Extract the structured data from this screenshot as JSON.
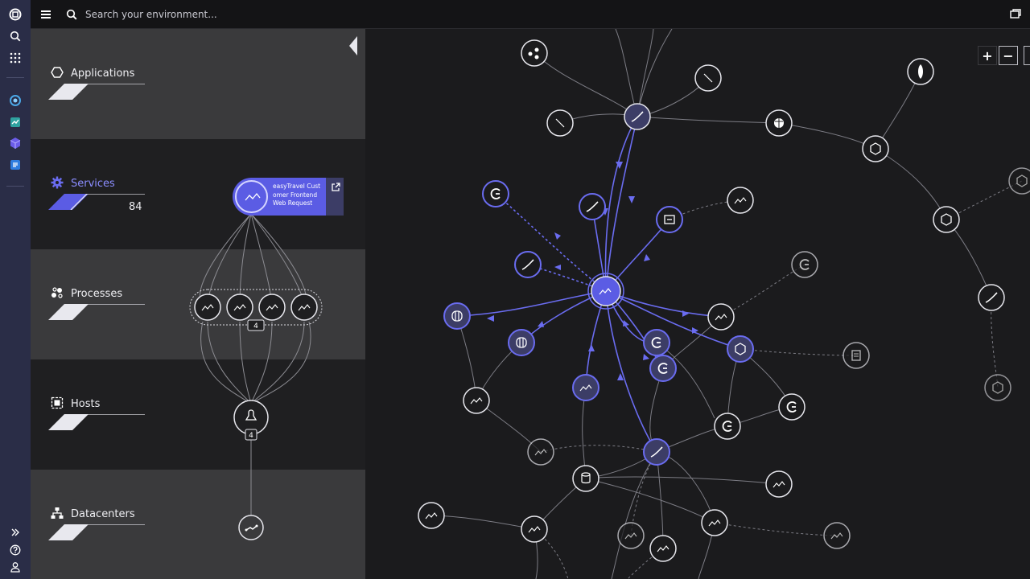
{
  "search": {
    "placeholder": "Search your environment..."
  },
  "layers": [
    {
      "key": "applications",
      "label": "Applications",
      "count": ""
    },
    {
      "key": "services",
      "label": "Services",
      "count": "84"
    },
    {
      "key": "processes",
      "label": "Processes",
      "count": ""
    },
    {
      "key": "hosts",
      "label": "Hosts",
      "count": ""
    },
    {
      "key": "datacenters",
      "label": "Datacenters",
      "count": ""
    }
  ],
  "selected_service": {
    "name": "easyTravel Customer Frontend Web Request"
  },
  "process_group": {
    "badge": "4"
  },
  "host_group": {
    "badge": "4"
  },
  "colors": {
    "accent": "#5b5ce4",
    "rail": "#2a2d47",
    "node_border": "#e6e6ec",
    "edge": "#8a8a92"
  },
  "zoom": {
    "in": "+",
    "out": "−"
  },
  "icons": [
    "dynatrace-logo-icon",
    "search-icon",
    "apps-grid-icon",
    "hexagon-icon",
    "gear-icon",
    "processes-icon",
    "hosts-icon",
    "datacenter-icon",
    "windows-icon",
    "menu-icon",
    "external-link-icon",
    "collapse-icon",
    "expand-icon",
    "help-icon",
    "user-icon"
  ]
}
